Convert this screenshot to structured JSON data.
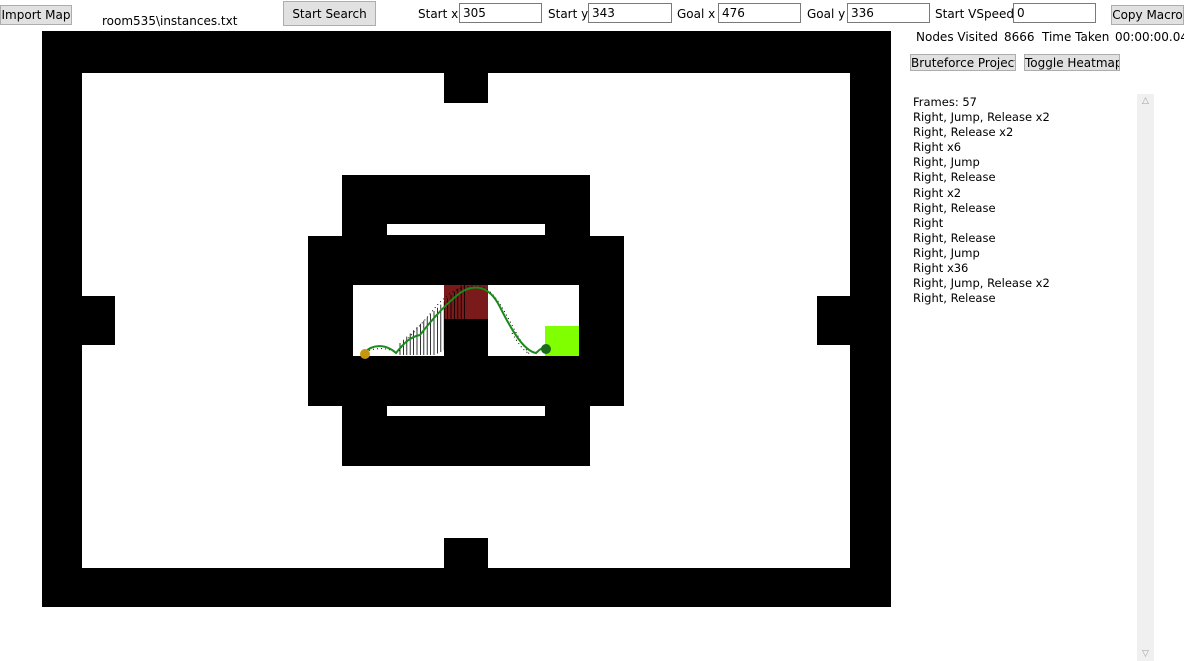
{
  "toolbar": {
    "import_label": "Import Map",
    "file_path": "room535\\instances.txt",
    "start_search_label": "Start Search",
    "start_x_label": "Start x",
    "start_x_value": "305",
    "start_y_label": "Start y",
    "start_y_value": "343",
    "goal_x_label": "Goal x",
    "goal_x_value": "476",
    "goal_y_label": "Goal y",
    "goal_y_value": "336",
    "start_vspeed_label": "Start VSpeed",
    "start_vspeed_value": "0",
    "copy_macro_label": "Copy Macro"
  },
  "stats": {
    "nodes_label": "Nodes Visited",
    "nodes_value": "8666",
    "time_label": "Time Taken",
    "time_value": "00:00:00.04"
  },
  "actions": {
    "bruteforce_label": "Bruteforce Project",
    "heatmap_label": "Toggle Heatmap"
  },
  "macro": {
    "lines": [
      "Frames: 57",
      "Right, Jump, Release x2",
      "Right, Release x2",
      "Right x6",
      "Right, Jump",
      "Right, Release",
      "Right x2",
      "Right, Release",
      "Right",
      "Right, Release",
      "Right, Jump",
      "Right x36",
      "Right, Jump, Release x2",
      "Right, Release"
    ]
  },
  "colors": {
    "wall": "#000000",
    "floor": "#ffffff",
    "hazard": "#7b1a1a",
    "goal_zone": "#80ff00",
    "path": "#1a8a1a",
    "start_marker": "#c8960c",
    "goal_marker": "#1a6a1a"
  }
}
